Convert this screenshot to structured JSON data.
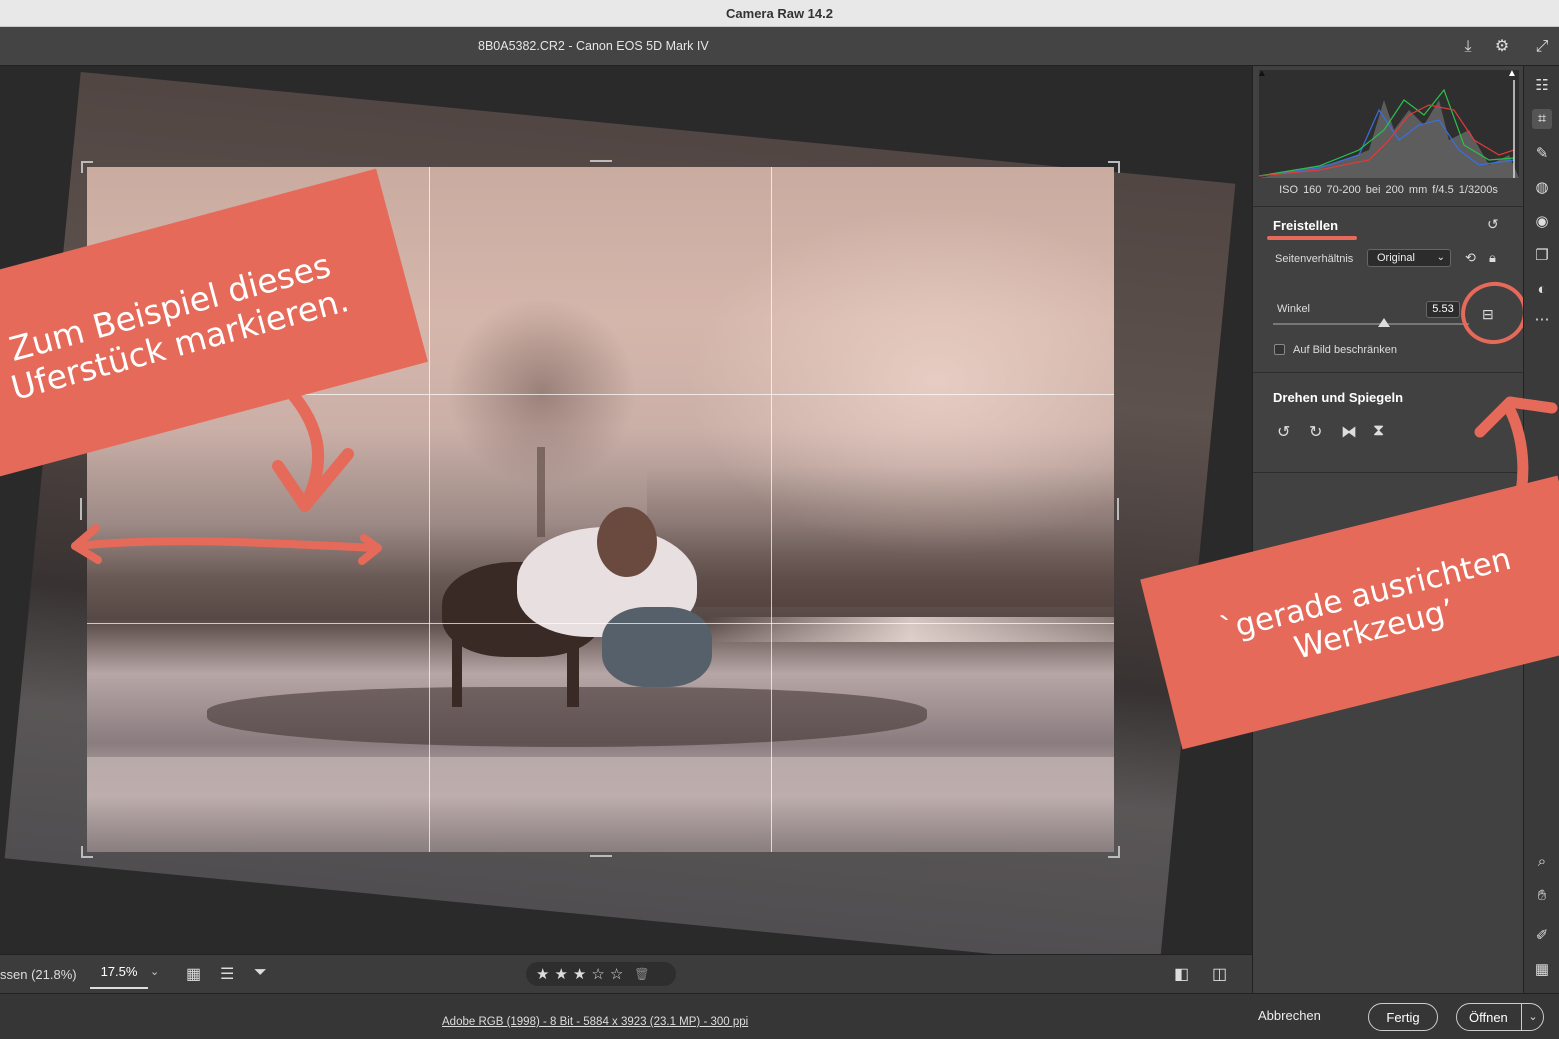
{
  "window": {
    "title": "Camera Raw 14.2"
  },
  "header": {
    "filename": "8B0A5382.CR2 - Canon EOS 5D Mark IV",
    "icons": [
      "save-icon",
      "gear-icon",
      "expand-icon"
    ]
  },
  "annotations": {
    "banner_left": [
      "Zum Beispiel dieses",
      "Uferstück markieren."
    ],
    "banner_right": [
      "`gerade ausrichten",
      "Werkzeug’"
    ],
    "accent_color": "#e66a5a"
  },
  "canvas_bar": {
    "fit_label": "ssen (21.8%)",
    "zoom": "17.5%",
    "zoom_dropdown": "⌄",
    "rating_stars": [
      "★",
      "★",
      "★",
      "☆",
      "☆"
    ],
    "trash": "🗑"
  },
  "footer": {
    "info": "Adobe RGB (1998) - 8 Bit - 5884 x 3923 (23.1 MP) - 300 ppi",
    "cancel": "Abbrechen",
    "done": "Fertig",
    "open": "Öffnen",
    "open_arrow": "⌄"
  },
  "panel": {
    "camera_info": "ISO 160   70-200 bei 200 mm   f/4.5   1/3200s",
    "crop": {
      "title": "Freistellen",
      "aspect_label": "Seitenverhältnis",
      "aspect_value": "Original",
      "angle_label": "Winkel",
      "angle_value": "5.53",
      "constrain_label": "Auf Bild beschränken"
    },
    "rotate": {
      "title": "Drehen und Spiegeln"
    }
  }
}
